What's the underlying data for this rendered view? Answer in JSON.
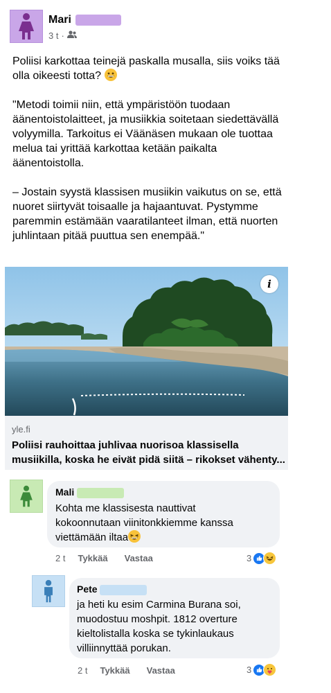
{
  "post": {
    "author": "Mari",
    "time": "3 t",
    "separator": "·",
    "text": [
      "Poliisi karkottaa teinejä paskalla musalla, siis voiks tää olla oikeesti totta?",
      "\"Metodi toimii niin, että ympäristöön tuodaan äänentoistolaitteet, ja musiikkia soitetaan siedettävällä volyymilla. Tarkoitus ei Väänäsen mukaan ole tuottaa melua tai yrittää karkottaa ketään paikalta äänentoistolla.",
      "– Jostain syystä klassisen musiikin vaikutus on se, että nuoret siirtyvät toisaalle ja hajaantuvat. Pystymme paremmin estämään vaaratilanteet ilman, että nuorten juhlintaan pitää puuttua sen enempää.\""
    ],
    "link": {
      "domain": "yle.fi",
      "title": "Poliisi rauhoittaa juhlivaa nuorisoa klassisella musiikilla, koska he eivät pidä siitä – rikokset vähenty...",
      "info": "i"
    }
  },
  "comments": [
    {
      "author": "Mali",
      "text": "Kohta me klassisesta nauttivat kokoonnutaan viinitonkkiemme kanssa viettämään iltaa",
      "time": "2 t",
      "like": "Tykkää",
      "reply": "Vastaa",
      "reaction_count": "3"
    },
    {
      "author": "Pete",
      "text": "ja heti ku esim Carmina Burana soi,  muodostuu moshpit. 1812 overture kieltolistalla koska se tykinlaukaus villiinnyttää porukan.",
      "time": "2 t",
      "like": "Tykkää",
      "reply": "Vastaa",
      "reaction_count": "3"
    }
  ],
  "colors": {
    "post_avatar": "#c9a6e8",
    "mali_avatar": "#c8eab4",
    "pete_avatar": "#c6e0f5",
    "bubble": "#f0f2f5",
    "like_blue": "#1877f2"
  }
}
